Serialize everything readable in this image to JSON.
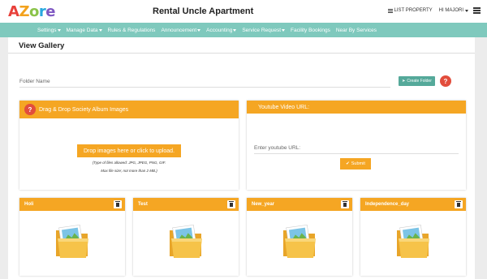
{
  "header": {
    "logo": [
      "A",
      "Z",
      "o",
      "r",
      "e"
    ],
    "title": "Rental Uncle Apartment",
    "list_property": "LIST PROPERTY",
    "user_greeting": "HI MAJORI"
  },
  "nav": {
    "items": [
      {
        "label": "Settings",
        "dropdown": true
      },
      {
        "label": "Manage Data",
        "dropdown": true
      },
      {
        "label": "Rules & Regulations",
        "dropdown": false
      },
      {
        "label": "Announcement",
        "dropdown": true
      },
      {
        "label": "Accounting",
        "dropdown": true
      },
      {
        "label": "Service Request",
        "dropdown": true
      },
      {
        "label": "Facility Bookings",
        "dropdown": false
      },
      {
        "label": "Near By Services",
        "dropdown": false
      }
    ]
  },
  "gallery": {
    "title": "View Gallery",
    "folder_name_placeholder": "Folder Name",
    "create_folder_label": "Create Folder",
    "help_symbol": "?"
  },
  "upload": {
    "header": "Drag & Drop Society Album Images",
    "button": "Drop images here or click to upload.",
    "note1": "(Type of files allowed: JPG, JPEG, PNG, GIF.",
    "note2": "Max file size; not more than 2 MB.)"
  },
  "youtube": {
    "header": "Youtube Video URL:",
    "placeholder": "Enter youtube URL:",
    "submit": "Submit"
  },
  "albums": [
    {
      "name": "Holi"
    },
    {
      "name": "Test"
    },
    {
      "name": "New_year"
    },
    {
      "name": "Independence_day"
    }
  ],
  "colors": {
    "teal_nav": "#7fc9bd",
    "orange": "#f5a623",
    "create_button": "#55a99a",
    "help_red": "#e24d3c"
  }
}
